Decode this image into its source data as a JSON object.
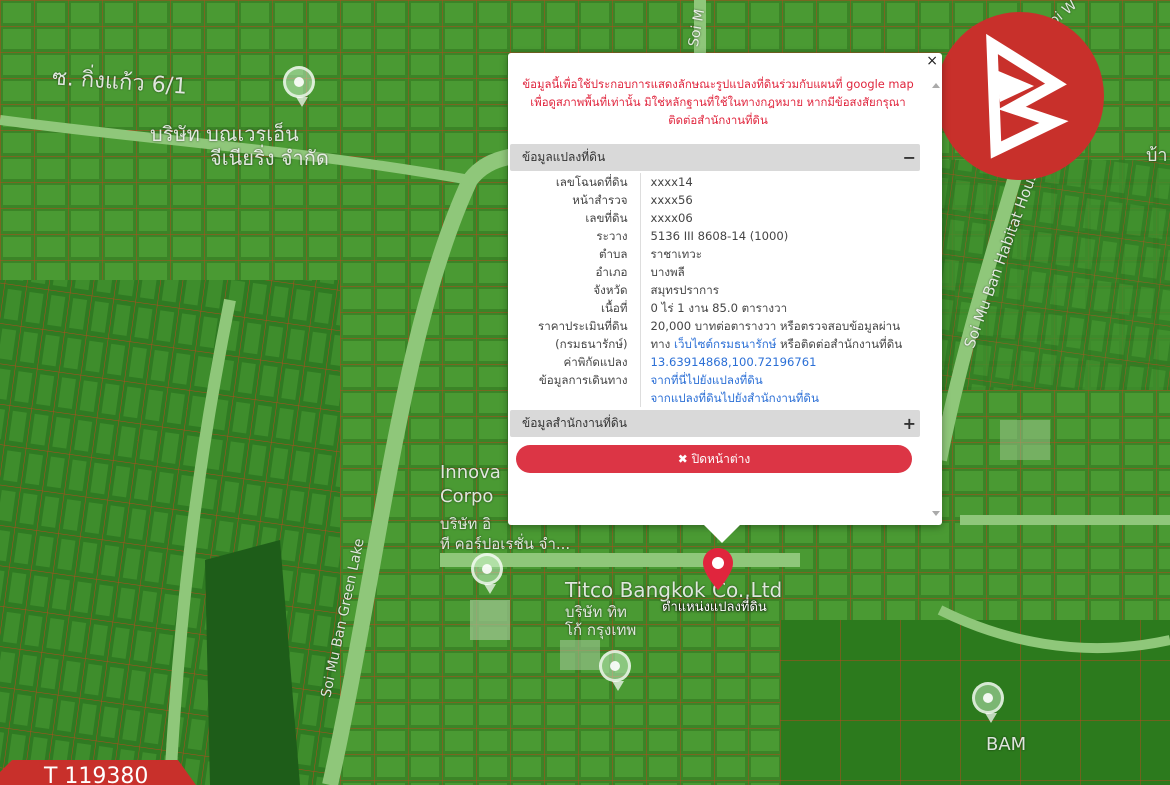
{
  "map": {
    "labels": {
      "soi_kingkaeo": "ซ. กิ่งแก้ว 6/1",
      "company_thai_1": "บริษัท บณเวรเอ็น",
      "company_thai_2": "จีเนียริ่ง จำกัด",
      "soi_m": "Soi M",
      "soi_w": "Soi W",
      "habitat": "Soi Mu Ban Habitat Housing",
      "green_lake": "Soi Mu Ban Green Lake",
      "innova_1": "Innova",
      "innova_2": "Corpo",
      "innova_th_1": "บริษัท อิ",
      "innova_th_2": "ที คอร์ปอเรชั่น จำ...",
      "titco": "Titco Bangkok Co.,Ltd",
      "titco_th_1": "บริษัท ทิท",
      "titco_th_2": "โก้ กรุงเทพ",
      "bam": "BAM",
      "right_edge": "บ้า"
    },
    "location_label": "ตำแหน่งแปลงที่ดิน"
  },
  "popup": {
    "close_symbol": "×",
    "disclaimer": "ข้อมูลนี้เพื่อใช้ประกอบการแสดงลักษณะรูปแปลงที่ดินร่วมกับแผนที่ google map เพื่อดูสภาพพื้นที่เท่านั้น มิใช่หลักฐานที่ใช้ในทางกฎหมาย หากมีข้อสงสัยกรุณาติดต่อสำนักงานที่ดิน",
    "land_section": {
      "title": "ข้อมูลแปลงที่ดิน",
      "toggle": "−",
      "rows": {
        "deed_no": {
          "k": "เลขโฉนดที่ดิน",
          "v": "xxxx14"
        },
        "survey_page": {
          "k": "หน้าสำรวจ",
          "v": "xxxx56"
        },
        "land_no": {
          "k": "เลขที่ดิน",
          "v": "xxxx06"
        },
        "sheet": {
          "k": "ระวาง",
          "v": "5136 III 8608-14 (1000)"
        },
        "subdistrict": {
          "k": "ตำบล",
          "v": "ราชาเทวะ"
        },
        "district": {
          "k": "อำเภอ",
          "v": "บางพลี"
        },
        "province": {
          "k": "จังหวัด",
          "v": "สมุทรปราการ"
        },
        "area": {
          "k": "เนื้อที่",
          "v": "0 ไร่ 1 งาน 85.0 ตารางวา"
        },
        "appraisal": {
          "k1": "ราคาประเมินที่ดิน",
          "v1": "20,000 บาทต่อตารางวา หรือตรวจสอบข้อมูลผ่าน",
          "k2": "(กรมธนารักษ์)",
          "v2a": "ทาง ",
          "v2link": "เว็บไซต์กรมธนารักษ์",
          "v2b": " หรือติดต่อสำนักงานที่ดิน"
        },
        "coords": {
          "k": "ค่าพิกัดแปลง",
          "v": "13.63914868,100.72196761"
        },
        "travel": {
          "k": "ข้อมูลการเดินทาง",
          "v1": "จากที่นี่ไปยังแปลงที่ดิน",
          "v2": "จากแปลงที่ดินไปยังสำนักงานที่ดิน"
        }
      }
    },
    "office_section": {
      "title": "ข้อมูลสำนักงานที่ดิน",
      "toggle": "+"
    },
    "close_button": {
      "icon": "✖",
      "label": "ปิดหน้าต่าง"
    }
  },
  "watermark": {
    "text": "T 119380"
  },
  "colors": {
    "map_green": "#3f8a2a",
    "parcel_line": "#b34a1e",
    "road": "#8fc77a",
    "alert_red": "#e0253d",
    "button_red": "#dc3545",
    "logo_red": "#c8302b",
    "link_blue": "#2b6fd6"
  },
  "icons": {
    "logo": "brand-logo-icon",
    "close": "close-icon",
    "location": "map-pin-icon",
    "poi": "poi-pin-icon"
  }
}
